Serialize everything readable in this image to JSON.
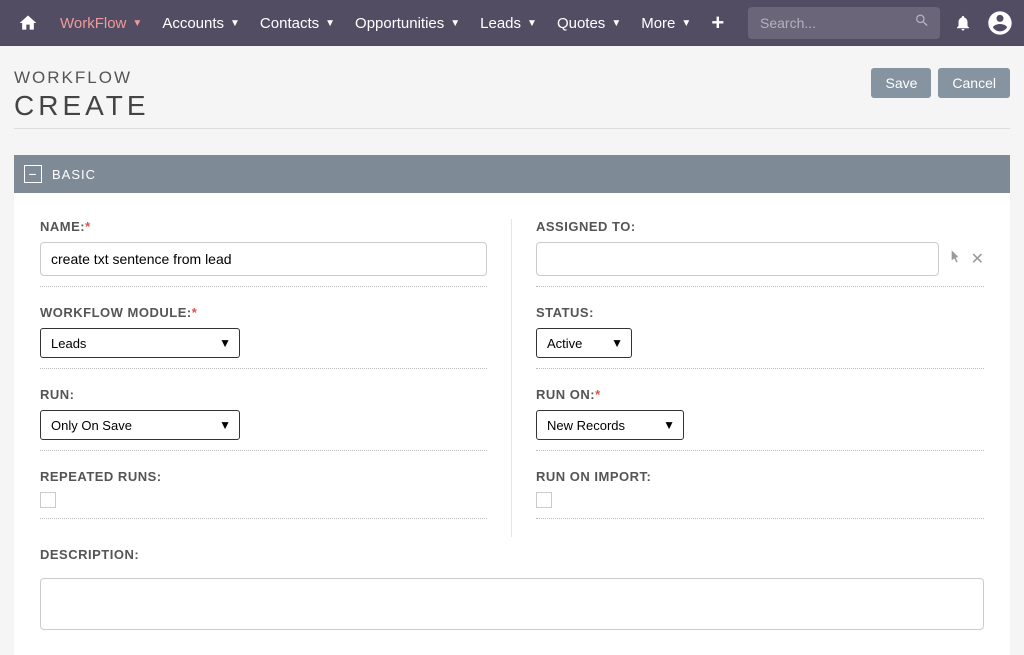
{
  "nav": {
    "items": [
      {
        "label": "WorkFlow",
        "active": true
      },
      {
        "label": "Accounts"
      },
      {
        "label": "Contacts"
      },
      {
        "label": "Opportunities"
      },
      {
        "label": "Leads"
      },
      {
        "label": "Quotes"
      },
      {
        "label": "More"
      }
    ],
    "search_placeholder": "Search..."
  },
  "header": {
    "supertitle": "WORKFLOW",
    "title": "CREATE",
    "save_label": "Save",
    "cancel_label": "Cancel"
  },
  "section": {
    "title": "BASIC"
  },
  "form": {
    "name": {
      "label": "NAME:",
      "value": "create txt sentence from lead"
    },
    "assigned_to": {
      "label": "ASSIGNED TO:",
      "value": ""
    },
    "workflow_module": {
      "label": "WORKFLOW MODULE:",
      "value": "Leads"
    },
    "status": {
      "label": "STATUS:",
      "value": "Active"
    },
    "run": {
      "label": "RUN:",
      "value": "Only On Save"
    },
    "run_on": {
      "label": "RUN ON:",
      "value": "New Records"
    },
    "repeated_runs": {
      "label": "REPEATED RUNS:"
    },
    "run_on_import": {
      "label": "RUN ON IMPORT:"
    },
    "description": {
      "label": "DESCRIPTION:",
      "value": ""
    }
  }
}
